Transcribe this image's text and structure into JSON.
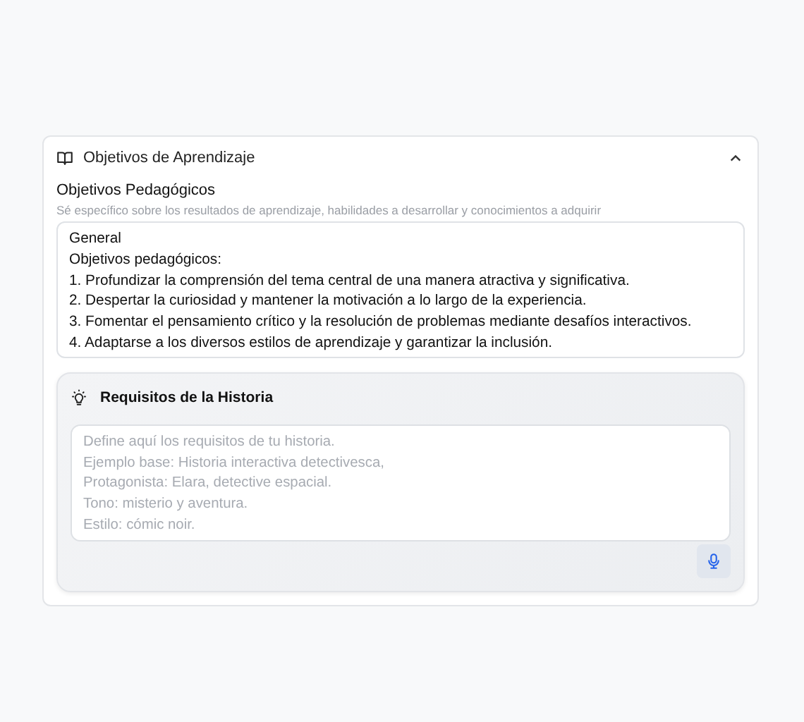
{
  "section": {
    "title": "Objetivos de Aprendizaje",
    "expanded": true
  },
  "objectives_field": {
    "label": "Objetivos Pedagógicos",
    "hint": "Sé específico sobre los resultados de aprendizaje, habilidades a desarrollar y conocimientos a adquirir",
    "value": "General\nObjetivos pedagógicos:\n1. Profundizar la comprensión del tema central de una manera atractiva y significativa.\n2. Despertar la curiosidad y mantener la motivación a lo largo de la experiencia.\n3. Fomentar el pensamiento crítico y la resolución de problemas mediante desafíos interactivos.\n4. Adaptarse a los diversos estilos de aprendizaje y garantizar la inclusión."
  },
  "requirements": {
    "title": "Requisitos de la Historia",
    "placeholder": "Define aquí los requisitos de tu historia.\nEjemplo base: Historia interactiva detectivesca,\nProtagonista: Elara, detective espacial.\nTono: misterio y aventura.\nEstilo: cómic noir."
  }
}
